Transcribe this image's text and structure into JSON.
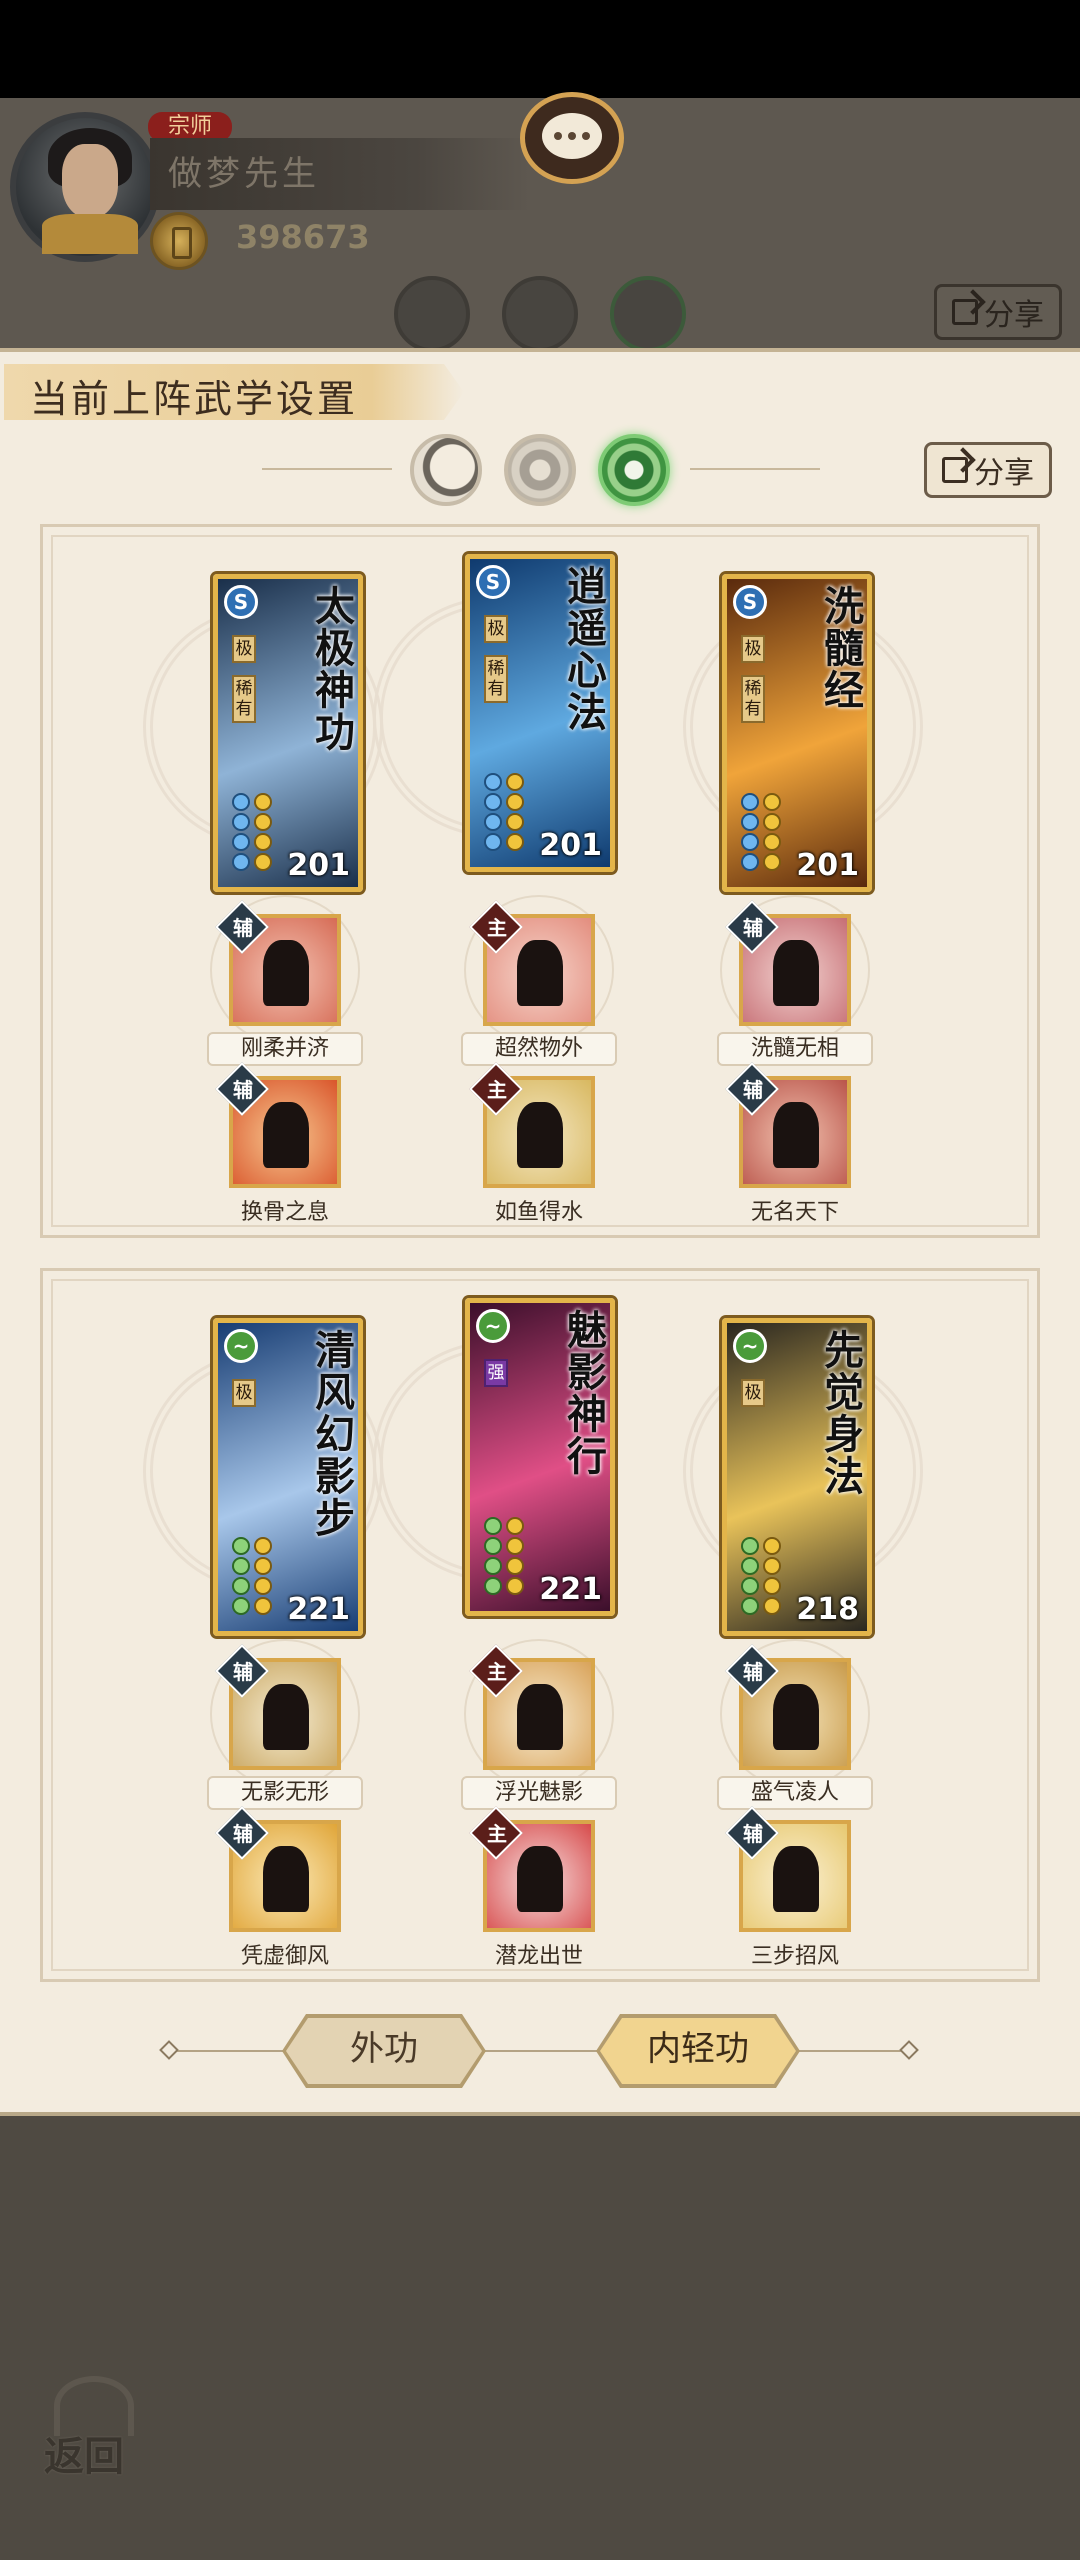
{
  "player": {
    "rank": "宗师",
    "name": "做梦先生",
    "currency": "398673"
  },
  "header": {
    "share_label": "分享"
  },
  "panel": {
    "title": "当前上阵武学设置",
    "share_label": "分享"
  },
  "stances": [
    {
      "name": "moon-stance",
      "selected": false
    },
    {
      "name": "sun-stance",
      "selected": false
    },
    {
      "name": "jade-stance",
      "selected": true
    }
  ],
  "groups": [
    {
      "cards": [
        {
          "title": "太极神功",
          "level": "201",
          "icon": "S",
          "tags": [
            "极",
            "稀有"
          ],
          "art": [
            "#1a2f4a",
            "#8fb3d6"
          ]
        },
        {
          "title": "逍遥心法",
          "level": "201",
          "icon": "S",
          "tags": [
            "极",
            "稀有"
          ],
          "art": [
            "#0f3a6e",
            "#5fa9e0"
          ]
        },
        {
          "title": "洗髓经",
          "level": "201",
          "icon": "S",
          "tags": [
            "极",
            "稀有"
          ],
          "art": [
            "#5a2a0d",
            "#f0a43a"
          ]
        }
      ],
      "skills": [
        {
          "role": "辅",
          "name": "刚柔并济",
          "art": [
            "#f3c3b3",
            "#d66b55"
          ]
        },
        {
          "role": "主",
          "name": "超然物外",
          "art": [
            "#f6d5cb",
            "#e38d7e"
          ]
        },
        {
          "role": "辅",
          "name": "洗髓无相",
          "art": [
            "#f2d2cf",
            "#c66e74"
          ]
        },
        {
          "role": "辅",
          "name": "换骨之息",
          "art": [
            "#f7c890",
            "#d9552b"
          ]
        },
        {
          "role": "主",
          "name": "如鱼得水",
          "art": [
            "#f4e7c3",
            "#d8b860"
          ]
        },
        {
          "role": "辅",
          "name": "无名天下",
          "art": [
            "#f2c3b0",
            "#b9544a"
          ]
        }
      ]
    },
    {
      "cards": [
        {
          "title": "清风幻影步",
          "level": "221",
          "icon": "~",
          "tags": [
            "极"
          ],
          "art": [
            "#183d73",
            "#a8c7ea"
          ]
        },
        {
          "title": "魅影神行",
          "level": "221",
          "icon": "~",
          "tags": [
            "强"
          ],
          "art": [
            "#3b0f2b",
            "#e04f86"
          ]
        },
        {
          "title": "先觉身法",
          "level": "218",
          "icon": "~",
          "tags": [
            "极"
          ],
          "art": [
            "#2a2720",
            "#e9c35a"
          ]
        }
      ],
      "skills": [
        {
          "role": "辅",
          "name": "无影无形",
          "art": [
            "#f5ecd2",
            "#c9a660"
          ]
        },
        {
          "role": "主",
          "name": "浮光魅影",
          "art": [
            "#f7ecd2",
            "#d9a35a"
          ]
        },
        {
          "role": "辅",
          "name": "盛气凌人",
          "art": [
            "#f3e2b8",
            "#c89a4a"
          ]
        },
        {
          "role": "辅",
          "name": "凭虚御风",
          "art": [
            "#fbe9b6",
            "#e0a538"
          ]
        },
        {
          "role": "主",
          "name": "潜龙出世",
          "art": [
            "#f6dede",
            "#d74b4b"
          ]
        },
        {
          "role": "辅",
          "name": "三步招风",
          "art": [
            "#fbf1d4",
            "#e7c870"
          ]
        }
      ]
    }
  ],
  "modes": {
    "external": "外功",
    "internal": "内轻功",
    "active": "internal"
  },
  "footer": {
    "back_label": "返回"
  },
  "colors": {
    "accent_gold": "#e3b54a",
    "panel_bg": "#f3ecdf",
    "jade_selected": "#3f9441"
  }
}
